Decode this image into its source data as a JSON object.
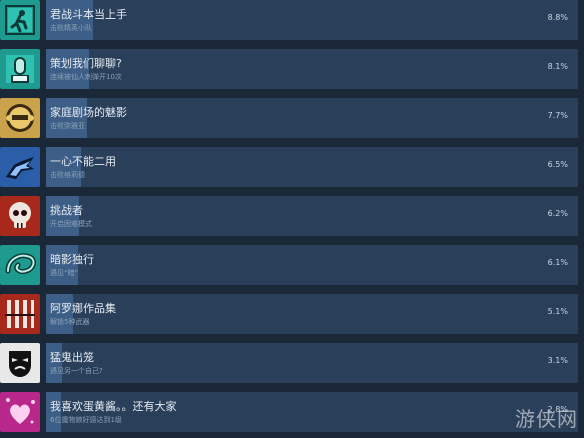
{
  "achievements": [
    {
      "title": "君战斗本当上手",
      "description": "击败精英小队",
      "percent": "8.8%",
      "value": 8.8,
      "icon": "running-exit-icon",
      "color": "#1f9a8e"
    },
    {
      "title": "策划我们聊聊?",
      "description": "连续被仙人刺弹开10次",
      "percent": "8.1%",
      "value": 8.1,
      "icon": "cactus-icon",
      "color": "#1f9a8e"
    },
    {
      "title": "家庭剧场的魅影",
      "description": "击败弥雅亚",
      "percent": "7.7%",
      "value": 7.7,
      "icon": "round-helmet-icon",
      "color": "#caa24a"
    },
    {
      "title": "一心不能二用",
      "description": "击败格莉德",
      "percent": "6.5%",
      "value": 6.5,
      "icon": "dragon-head-icon",
      "color": "#2a5ea8"
    },
    {
      "title": "挑战者",
      "description": "开启困难模式",
      "percent": "6.2%",
      "value": 6.2,
      "icon": "skull-icon",
      "color": "#a8281c"
    },
    {
      "title": "暗影独行",
      "description": "遇见“暗”",
      "percent": "6.1%",
      "value": 6.1,
      "icon": "dragon-coil-icon",
      "color": "#1f9a8e"
    },
    {
      "title": "阿罗娜作品集",
      "description": "解锁5种武器",
      "percent": "5.1%",
      "value": 5.1,
      "icon": "weapons-rack-icon",
      "color": "#a8281c"
    },
    {
      "title": "猛鬼出笼",
      "description": "遇见另一个自己?",
      "percent": "3.1%",
      "value": 3.1,
      "icon": "theater-mask-icon",
      "color": "#e8e8e8"
    },
    {
      "title": "我喜欢蛋黄酱。。还有大家",
      "description": "6位魔物娘好感达到1级",
      "percent": "2.8%",
      "value": 2.8,
      "icon": "hearts-icon",
      "color": "#b8288a"
    }
  ],
  "watermark": "游侠网"
}
